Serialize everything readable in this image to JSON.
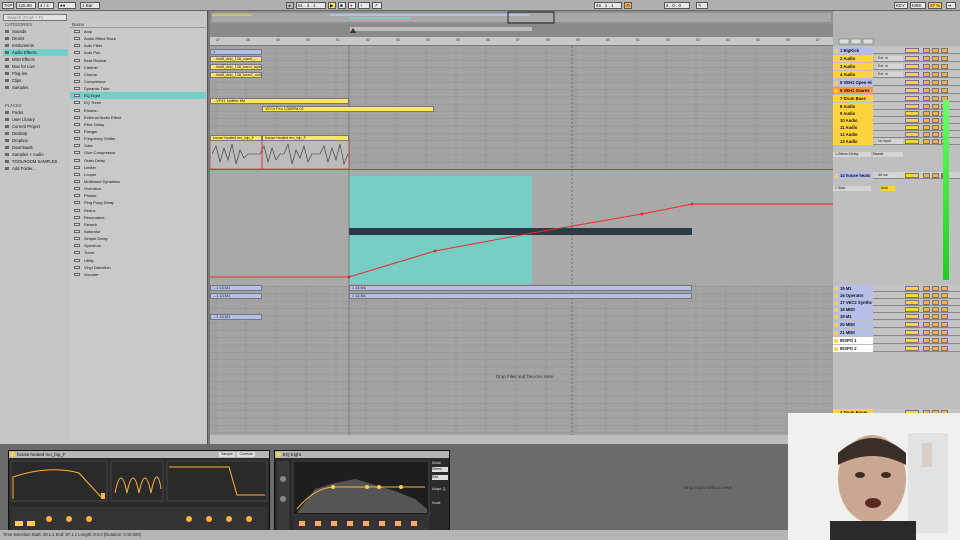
{
  "topbar": {
    "tap": "TAP",
    "tempo": "125.00",
    "time_sig": "4 / 4",
    "quantize": "1 Bar",
    "position": "51 . 3 . 1",
    "loop_start": "49 . 1 . 1",
    "loop_len": "4 . 0 . 0",
    "key": "KEY",
    "midi": "MIDI",
    "cpu": "37 %"
  },
  "browser": {
    "search_placeholder": "Search (Cmd + F)",
    "categories_title": "CATEGORIES",
    "categories": [
      "Sounds",
      "Drums",
      "Instruments",
      "Audio Effects",
      "MIDI Effects",
      "Max for Live",
      "Plug-ins",
      "Clips",
      "Samples"
    ],
    "places_title": "PLACES",
    "places": [
      "Packs",
      "User Library",
      "Current Project",
      "Desktop",
      "Dropbox",
      "Downloads",
      "Samples + Audio",
      "TOOLROOM SAMPLES",
      "Add Folder..."
    ],
    "list_header": "Name",
    "items": [
      "Amp",
      "Audio Effect Rack",
      "Auto Filter",
      "Auto Pan",
      "Beat Repeat",
      "Cabinet",
      "Chorus",
      "Compressor",
      "Dynamic Tube",
      "EQ Eight",
      "EQ Three",
      "Erosion",
      "External Audio Effect",
      "Filter Delay",
      "Flanger",
      "Frequency Shifter",
      "Gate",
      "Glue Compressor",
      "Grain Delay",
      "Limiter",
      "Looper",
      "Multiband Dynamics",
      "Overdrive",
      "Phaser",
      "Ping Pong Delay",
      "Redux",
      "Resonators",
      "Reverb",
      "Saturator",
      "Simple Delay",
      "Spectrum",
      "Tuner",
      "Utility",
      "Vinyl Distortion",
      "Vocoder"
    ]
  },
  "arrangement": {
    "ruler_ticks": [
      "47",
      "48",
      "49",
      "50",
      "51",
      "52",
      "53",
      "54",
      "55",
      "56",
      "57",
      "58",
      "59",
      "60",
      "61",
      "62",
      "63",
      "64",
      "65",
      "66",
      "67"
    ],
    "clips": [
      {
        "label": "1",
        "track": 1
      },
      {
        "label": "...inst5_drip_126_clanit_...",
        "track": 2
      },
      {
        "label": "...inst5_drip_126_band_tape",
        "track": 3
      },
      {
        "label": "...inst5_drip_126_beat2_noise",
        "track": 4
      },
      {
        "label": "...VFX1 Uplifter 8M",
        "track": 7
      },
      {
        "label": "VEC4 FXs 128BPM 02",
        "track": 8
      },
      {
        "label": "house heated mo_bip_F",
        "track": 11
      },
      {
        "label": "house heated mo_bip_F",
        "track": 11
      },
      {
        "label": "...1 13-M1",
        "track": 15
      },
      {
        "label": "1 13-M1",
        "track": 15
      },
      {
        "label": "...1 13-M1",
        "track": 16
      },
      {
        "label": "1 13-M1",
        "track": 16
      },
      {
        "label": "...1 13-M1",
        "track": 19
      }
    ],
    "drop_hint": "Drop Files and Devices Here"
  },
  "mixer": {
    "tracks": [
      {
        "name": "1 BigKick",
        "color": "#b6bfea",
        "input": ""
      },
      {
        "name": "2 Audio",
        "color": "#ffd33d",
        "input": "Ext. In"
      },
      {
        "name": "3 Audio",
        "color": "#ffd33d",
        "input": "Ext. In"
      },
      {
        "name": "4 Audio",
        "color": "#ffd33d",
        "input": "Ext. In"
      },
      {
        "name": "5 VEH1 Open Hi",
        "color": "#b6bfea",
        "input": ""
      },
      {
        "name": "6 VEH1 Snares",
        "color": "#ff9a40",
        "input": ""
      },
      {
        "name": "7 Drum Buss",
        "color": "#ffd33d",
        "input": ""
      },
      {
        "name": "8 Audio",
        "color": "#ffd33d",
        "input": ""
      },
      {
        "name": "9 Audio",
        "color": "#ffd33d",
        "input": ""
      },
      {
        "name": "10 Audio",
        "color": "#ffd33d",
        "input": ""
      },
      {
        "name": "11 Audio",
        "color": "#ffd33d",
        "input": ""
      },
      {
        "name": "12 Audio",
        "color": "#ffd33d",
        "input": ""
      },
      {
        "name": "13 Audio",
        "color": "#ffd33d",
        "input": "No Input"
      },
      {
        "name": "14 house heats",
        "color": "#b6bfea",
        "input": "All Ins"
      },
      {
        "name": "15 M1",
        "color": "#b6bfea",
        "input": ""
      },
      {
        "name": "16 Operator",
        "color": "#b6bfea",
        "input": ""
      },
      {
        "name": "17 VEC2 Synths",
        "color": "#b6bfea",
        "input": ""
      },
      {
        "name": "18 MIDI",
        "color": "#b6bfea",
        "input": ""
      },
      {
        "name": "19 M1",
        "color": "#b6bfea",
        "input": ""
      },
      {
        "name": "20 MIDI",
        "color": "#b6bfea",
        "input": ""
      },
      {
        "name": "21 MIDI",
        "color": "#b6bfea",
        "input": ""
      },
      {
        "name": "INSPO 1",
        "color": "#ffffff",
        "input": ""
      },
      {
        "name": "INSPO 2",
        "color": "#ffffff",
        "input": ""
      },
      {
        "name": "4 Drum Room",
        "color": "#ffd33d",
        "input": ""
      }
    ],
    "master_label": "Master",
    "stereo_delay": "1-Stereo Delay",
    "autom_label": "Auto",
    "start_label": "1 Start"
  },
  "devices": {
    "simpler_title": "house heated mo_bip_F",
    "simpler_tabs": [
      "Sample",
      "Controls"
    ],
    "eq_title": "EQ Eight",
    "eq_mode_label": "Mode",
    "eq_mode_value": "Stereo",
    "eq_edit": "Edit",
    "eq_scale": "Scale",
    "eq_adapt_q": "Adapt. Q",
    "drop_hint": "Drop Audio Effects Here"
  },
  "status": {
    "text": "Time Selection   Start: 49.1.1   End: 57.1.1   Length: 8.0.0 (Duration: 0:15:360)"
  },
  "colors": {
    "selection": "#72d0c8",
    "automation": "#ee2a2a",
    "clip_yellow": "#ffe66b",
    "clip_blue": "#b6bfea"
  }
}
